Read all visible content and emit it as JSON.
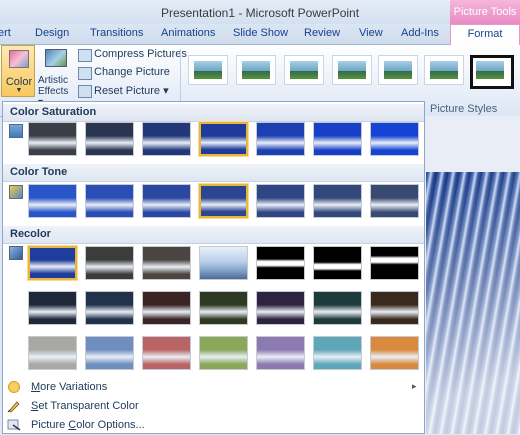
{
  "window": {
    "title": "Presentation1 - Microsoft PowerPoint",
    "contextual_tab_group": "Picture Tools"
  },
  "tabs": [
    "ert",
    "Design",
    "Transitions",
    "Animations",
    "Slide Show",
    "Review",
    "View",
    "Add-Ins",
    "Format"
  ],
  "active_tab": "Format",
  "ribbon": {
    "color_label": "Color",
    "color_dropdown_arrow": "▼",
    "artistic_label": "Artistic Effects",
    "artistic_arrow": "▾",
    "compress_label": "Compress Pictures",
    "change_label": "Change Picture",
    "reset_label": "Reset Picture",
    "reset_arrow": "▾",
    "picture_styles_label": "Picture Styles"
  },
  "gallery": {
    "sections": {
      "saturation": "Color Saturation",
      "tone": "Color Tone",
      "recolor": "Recolor"
    },
    "saturation_swatches": [
      "#3a3e46",
      "#2a3550",
      "#22367a",
      "#1f3a9a",
      "#1c3fb2",
      "#1840c6",
      "#1544d4"
    ],
    "saturation_selected_index": 3,
    "tone_swatches": [
      "#2855c8",
      "#2a4eb4",
      "#2a48a2",
      "#2c4590",
      "#2f4584",
      "#32477a",
      "#384a70"
    ],
    "tone_selected_index": 3,
    "recolor_row1": [
      "#1f3d9c",
      "#3c3c3c",
      "#4a4540",
      "#b8d0ea",
      "#000000",
      "#000000",
      "#000000"
    ],
    "recolor_row1_styles": [
      "photo",
      "photo",
      "photo",
      "light",
      "bw1",
      "bw2",
      "bw3"
    ],
    "recolor_row2": [
      "#1e2838",
      "#22324a",
      "#3a2424",
      "#2e3a22",
      "#2e2440",
      "#1f3a3a",
      "#3a2a1e"
    ],
    "recolor_row3": [
      "#a9a8a4",
      "#6e8fbe",
      "#b96565",
      "#8aa85a",
      "#8d7ab0",
      "#5fa7b8",
      "#d98a3e"
    ],
    "recolor_selected_index": 0,
    "menu": {
      "more_variations": {
        "label": "More Variations",
        "accel": "M",
        "arrow": "▸"
      },
      "set_transparent": {
        "label": "Set Transparent Color",
        "accel": "S"
      },
      "color_options": {
        "label": "Picture Color Options...",
        "accel": "C"
      }
    }
  },
  "colors": {
    "selected_border": "#e8b63d",
    "contextual_pink": "#e98bc4"
  }
}
